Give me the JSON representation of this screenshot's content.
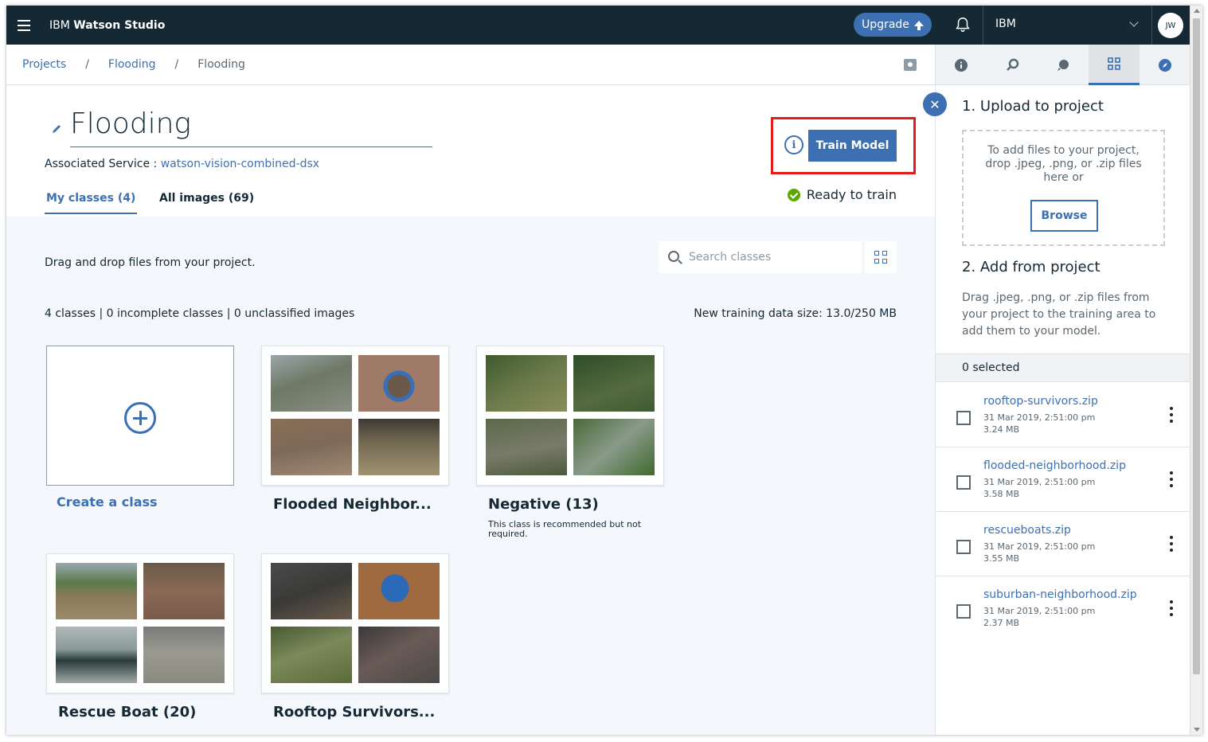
{
  "app": {
    "brand_prefix": "IBM",
    "brand_name": "Watson Studio",
    "upgrade_label": "Upgrade",
    "account_name": "IBM",
    "avatar_initials": "JW",
    "accent_color": "#3d70b2",
    "header_color": "#152935"
  },
  "breadcrumb": {
    "items": [
      "Projects",
      "Flooding"
    ],
    "current": "Flooding",
    "separator": "/"
  },
  "page": {
    "title": "Flooding",
    "associated_label": "Associated Service :",
    "associated_service": "watson-vision-combined-dsx",
    "tabs": [
      {
        "label": "My classes (4)",
        "active": true
      },
      {
        "label": "All images (69)",
        "active": false
      }
    ],
    "info_glyph": "i",
    "train_button": "Train Model",
    "status_text": "Ready to train",
    "status_color": "#5aa700"
  },
  "workarea": {
    "dnd_text": "Drag and drop files from your project.",
    "search_placeholder": "Search classes",
    "stats": "4 classes | 0 incomplete classes | 0 unclassified images",
    "data_size": "New training data size: 13.0/250 MB",
    "create_label": "Create a class",
    "classes": [
      {
        "label": "Flooded Neighbor...",
        "note": ""
      },
      {
        "label": "Negative (13)",
        "note": "This class is recommended but not required."
      },
      {
        "label": "Rescue Boat (20)",
        "note": ""
      },
      {
        "label": "Rooftop Survivors...",
        "note": ""
      }
    ]
  },
  "right_panel": {
    "tab_icons": [
      "info-icon",
      "wrench-icon",
      "compare-icon",
      "data-icon",
      "compass-icon"
    ],
    "close_glyph": "✕",
    "upload_heading": "1. Upload to project",
    "dropzone_text": "To add files to your project, drop .jpeg, .png, or .zip files here or",
    "browse_label": "Browse",
    "add_heading": "2. Add from project",
    "add_desc": "Drag .jpeg, .png, or .zip files from your project to the training area to add them to your model.",
    "selected_text": "0 selected",
    "files": [
      {
        "name": "rooftop-survivors.zip",
        "date": "31 Mar 2019, 2:51:00 pm",
        "size": "3.24 MB"
      },
      {
        "name": "flooded-neighborhood.zip",
        "date": "31 Mar 2019, 2:51:00 pm",
        "size": "3.58 MB"
      },
      {
        "name": "rescueboats.zip",
        "date": "31 Mar 2019, 2:51:00 pm",
        "size": "3.55 MB"
      },
      {
        "name": "suburban-neighborhood.zip",
        "date": "31 Mar 2019, 2:51:00 pm",
        "size": "2.37 MB"
      }
    ]
  }
}
